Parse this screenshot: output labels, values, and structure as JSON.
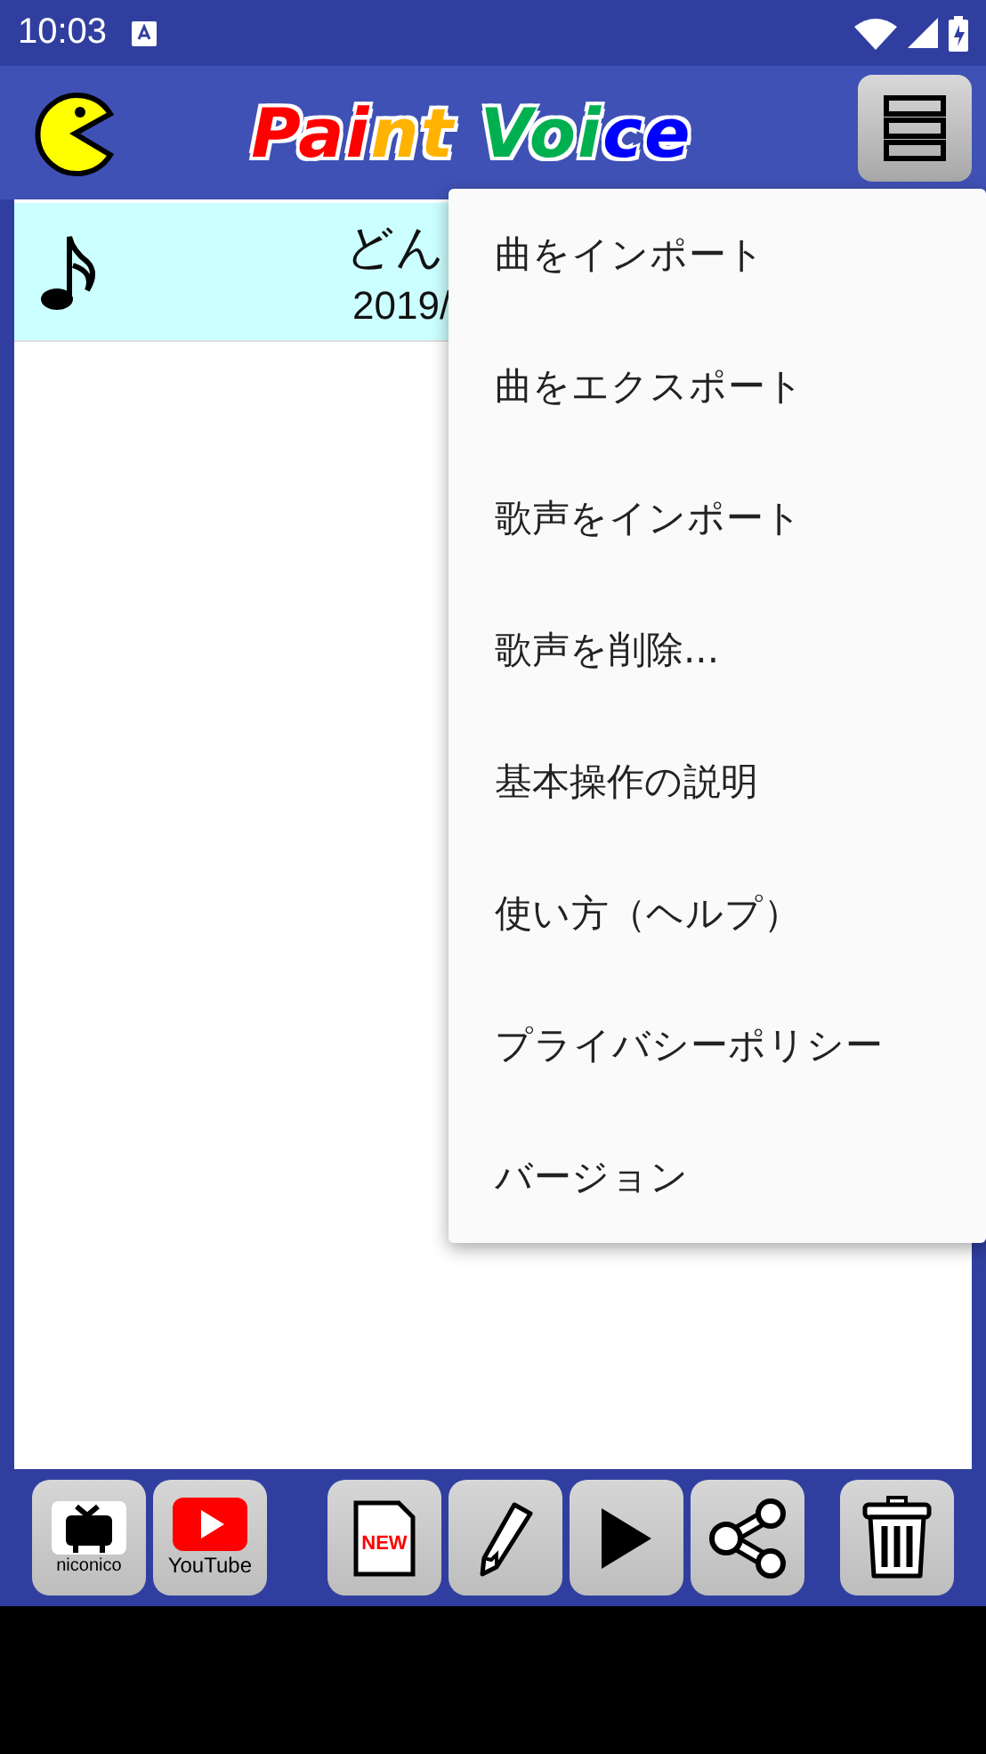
{
  "status_bar": {
    "time": "10:03"
  },
  "app_bar": {
    "title": [
      {
        "text": "Pai",
        "color": "#ff0000"
      },
      {
        "text": "nt ",
        "color": "#ffb300"
      },
      {
        "text": "Vo",
        "color": "#00b050"
      },
      {
        "text": "i",
        "color": "#00b050"
      },
      {
        "text": "ce",
        "color": "#0000ff"
      }
    ]
  },
  "song_list": [
    {
      "title": "どん",
      "date": "2019/",
      "selected": true
    }
  ],
  "menu": {
    "items": [
      "曲をインポート",
      "曲をエクスポート",
      "歌声をインポート",
      "歌声を削除...",
      "基本操作の説明",
      "使い方（ヘルプ）",
      "プライバシーポリシー",
      "バージョン"
    ]
  },
  "toolbar": {
    "buttons": [
      {
        "kind": "niconico",
        "label": "niconico"
      },
      {
        "kind": "youtube",
        "label": "YouTube"
      },
      {
        "kind": "new",
        "label": "NEW"
      },
      {
        "kind": "edit"
      },
      {
        "kind": "play"
      },
      {
        "kind": "share"
      },
      {
        "kind": "delete"
      }
    ]
  }
}
